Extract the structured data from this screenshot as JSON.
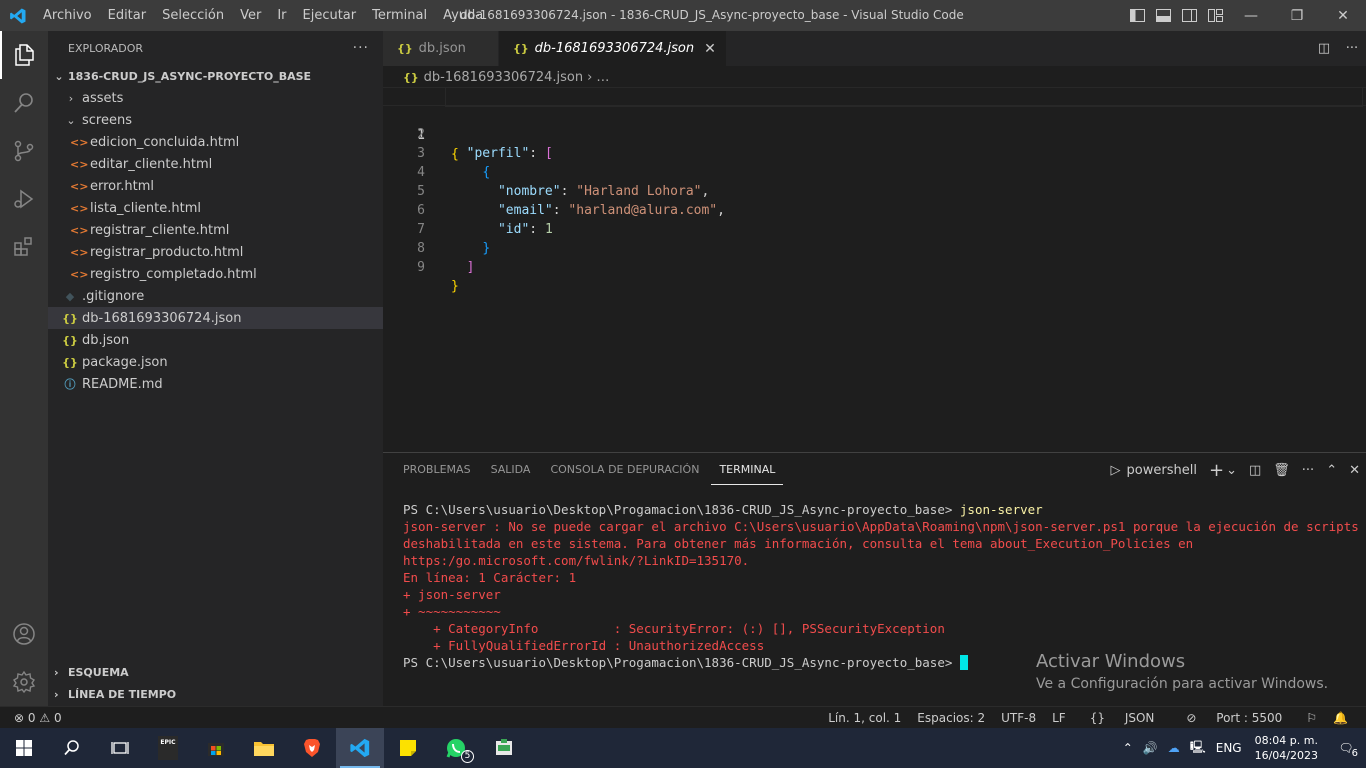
{
  "titlebar": {
    "menu": [
      "Archivo",
      "Editar",
      "Selección",
      "Ver",
      "Ir",
      "Ejecutar",
      "Terminal",
      "Ayuda"
    ],
    "title": "db-1681693306724.json - 1836-CRUD_JS_Async-proyecto_base - Visual Studio Code"
  },
  "sidebar": {
    "header": "EXPLORADOR",
    "root": "1836-CRUD_JS_ASYNC-PROYECTO_BASE",
    "folders": {
      "assets": "assets",
      "screens": "screens"
    },
    "screens_files": [
      "edicion_concluida.html",
      "editar_cliente.html",
      "error.html",
      "lista_cliente.html",
      "registrar_cliente.html",
      "registrar_producto.html",
      "registro_completado.html"
    ],
    "root_files": {
      "gitignore": ".gitignore",
      "db_active": "db-1681693306724.json",
      "db": "db.json",
      "package": "package.json",
      "readme": "README.md"
    },
    "outline": "ESQUEMA",
    "timeline": "LÍNEA DE TIEMPO"
  },
  "tabs": [
    {
      "label": "db.json"
    },
    {
      "label": "db-1681693306724.json",
      "active": true
    }
  ],
  "breadcrumb": {
    "file": "db-1681693306724.json",
    "more": "…"
  },
  "editor": {
    "line_numbers": [
      "1",
      "2",
      "3",
      "4",
      "5",
      "6",
      "7",
      "8",
      "9"
    ],
    "perfil_key": "\"perfil\"",
    "nombre_key": "\"nombre\"",
    "nombre_val": "\"Harland Lohora\"",
    "email_key": "\"email\"",
    "email_val": "\"harland@alura.com\"",
    "id_key": "\"id\"",
    "id_val": "1"
  },
  "panel": {
    "tabs": [
      "PROBLEMAS",
      "SALIDA",
      "CONSOLA DE DEPURACIÓN",
      "TERMINAL"
    ],
    "shell": "powershell",
    "prompt": "PS C:\\Users\\usuario\\Desktop\\Progamacion\\1836-CRUD_JS_Async-proyecto_base>",
    "command": "json-server",
    "error_lines": [
      "json-server : No se puede cargar el archivo C:\\Users\\usuario\\AppData\\Roaming\\npm\\json-server.ps1 porque la ejecución de scripts está",
      "deshabilitada en este sistema. Para obtener más información, consulta el tema about_Execution_Policies en",
      "https:/go.microsoft.com/fwlink/?LinkID=135170.",
      "En línea: 1 Carácter: 1",
      "+ json-server",
      "+ ~~~~~~~~~~~",
      "    + CategoryInfo          : SecurityError: (:) [], PSSecurityException",
      "    + FullyQualifiedErrorId : UnauthorizedAccess"
    ]
  },
  "watermark": {
    "title": "Activar Windows",
    "subtitle": "Ve a Configuración para activar Windows."
  },
  "statusbar": {
    "errors": "0",
    "warnings": "0",
    "position": "Lín. 1, col. 1",
    "spaces": "Espacios: 2",
    "encoding": "UTF-8",
    "eol": "LF",
    "language": "JSON",
    "port": "Port : 5500"
  },
  "taskbar": {
    "language": "ENG",
    "time": "08:04 p. m.",
    "date": "16/04/2023",
    "whatsapp_badge": "5",
    "notif_count": "6",
    "epic_label": "EPIC"
  },
  "colors": {
    "accent": "#007acc",
    "error_text": "#f14c4c",
    "cursor": "#00e5e5"
  }
}
